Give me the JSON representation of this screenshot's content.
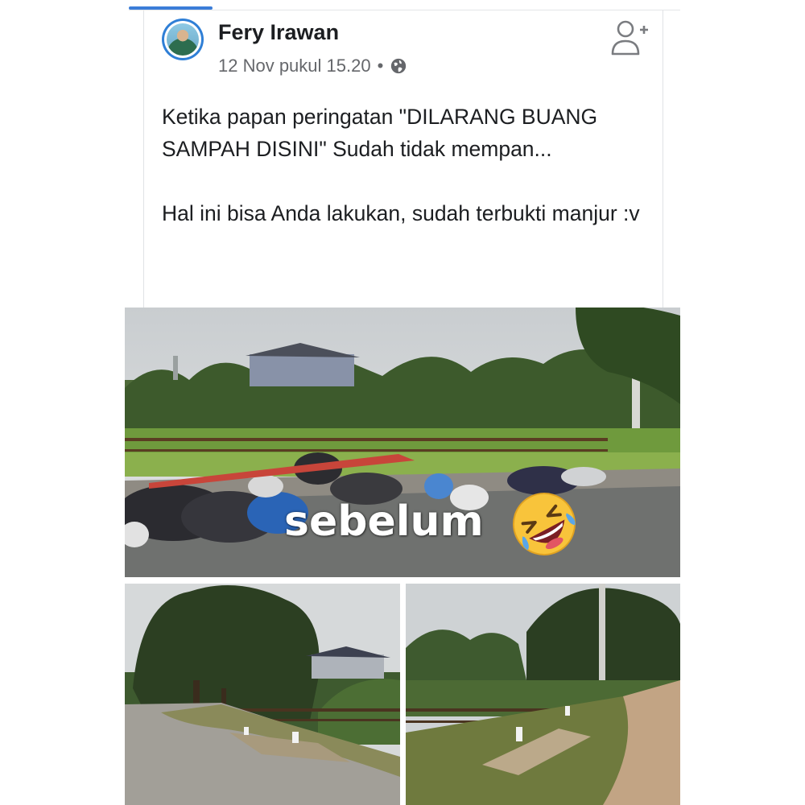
{
  "post": {
    "author": "Fery Irawan",
    "timestamp": "12 Nov pukul 15.20",
    "separator": "•",
    "privacy_icon": "globe-icon",
    "follow_icon": "add-friend-icon",
    "text": [
      "Ketika papan peringatan \"DILARANG BUANG SAMPAH DISINI\" Sudah tidak mempan...",
      "Hal ini bisa Anda lakukan, sudah terbukti manjur :v"
    ]
  },
  "photos": {
    "main_caption": "sebelum",
    "main_emoji": "rolling-on-floor-laughing-emoji"
  },
  "colors": {
    "accent": "#3b7dd8",
    "text_primary": "#1c1e21",
    "text_secondary": "#65676b"
  }
}
